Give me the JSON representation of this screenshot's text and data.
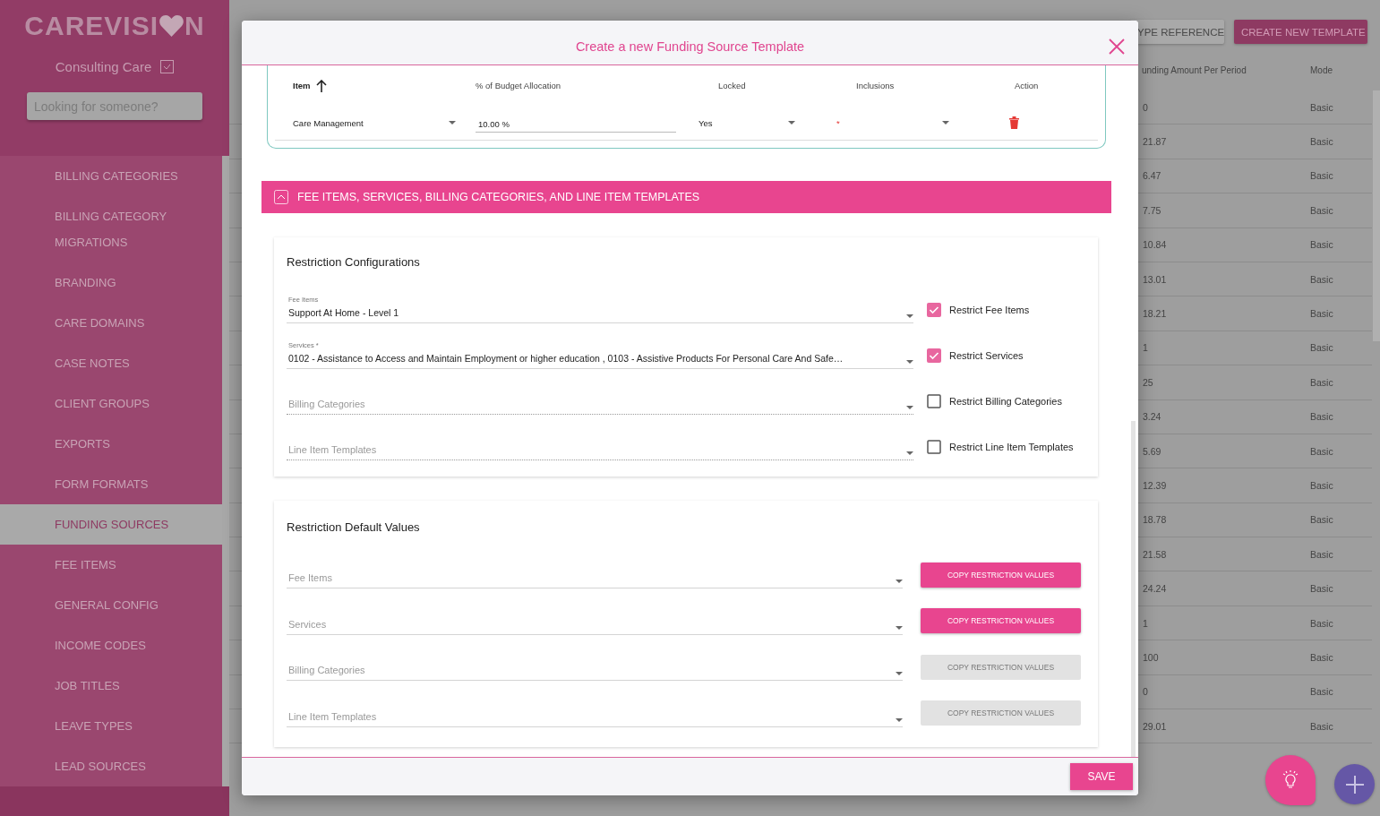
{
  "sidebar": {
    "logo": {
      "before_heart": "CAREVISI",
      "after_heart": "N"
    },
    "organisation": "Consulting Care",
    "search": {
      "placeholder": "Looking for someone?"
    },
    "items": [
      {
        "label": "BILLING CATEGORIES",
        "selected": false
      },
      {
        "label": "BILLING CATEGORY MIGRATIONS",
        "selected": false
      },
      {
        "label": "BRANDING",
        "selected": false
      },
      {
        "label": "CARE DOMAINS",
        "selected": false
      },
      {
        "label": "CASE NOTES",
        "selected": false
      },
      {
        "label": "CLIENT GROUPS",
        "selected": false
      },
      {
        "label": "EXPORTS",
        "selected": false
      },
      {
        "label": "FORM FORMATS",
        "selected": false
      },
      {
        "label": "FUNDING SOURCES",
        "selected": true
      },
      {
        "label": "FEE ITEMS",
        "selected": false
      },
      {
        "label": "GENERAL CONFIG",
        "selected": false
      },
      {
        "label": "INCOME CODES",
        "selected": false
      },
      {
        "label": "JOB TITLES",
        "selected": false
      },
      {
        "label": "LEAVE TYPES",
        "selected": false
      },
      {
        "label": "LEAD SOURCES",
        "selected": false
      }
    ]
  },
  "page": {
    "buttons": [
      {
        "label": "YPE REFERENCE",
        "kind": "secondary"
      },
      {
        "label": "CREATE NEW TEMPLATE",
        "kind": "primary"
      }
    ],
    "table": {
      "columns": [
        "unding Amount Per Period",
        "Mode"
      ],
      "rows": [
        {
          "amount": "0",
          "mode": "Basic"
        },
        {
          "amount": "21.87",
          "mode": "Basic"
        },
        {
          "amount": "6.47",
          "mode": "Basic"
        },
        {
          "amount": "7.75",
          "mode": "Basic"
        },
        {
          "amount": "10.84",
          "mode": "Basic"
        },
        {
          "amount": "13.01",
          "mode": "Basic"
        },
        {
          "amount": "18.21",
          "mode": "Basic"
        },
        {
          "amount": "1",
          "mode": "Basic"
        },
        {
          "amount": "25",
          "mode": "Basic"
        },
        {
          "amount": "3.24",
          "mode": "Basic"
        },
        {
          "amount": "5.69",
          "mode": "Basic"
        },
        {
          "amount": "12.39",
          "mode": "Basic"
        },
        {
          "amount": "18.78",
          "mode": "Basic"
        },
        {
          "amount": "21.58",
          "mode": "Basic"
        },
        {
          "amount": "24.24",
          "mode": "Basic"
        },
        {
          "amount": "1",
          "mode": "Basic"
        },
        {
          "amount": "100",
          "mode": "Basic"
        },
        {
          "amount": "0",
          "mode": "Basic"
        },
        {
          "amount": "29.01",
          "mode": "Basic"
        }
      ]
    }
  },
  "modal": {
    "title": "Create a new Funding Source Template",
    "items_table": {
      "columns": [
        "Item",
        "% of Budget Allocation",
        "Locked",
        "Inclusions",
        "Action"
      ],
      "sort_ascending": true,
      "rows": [
        {
          "item": "Care Management",
          "allocation": "10.00 %",
          "locked": "Yes",
          "inclusions": "*"
        }
      ]
    },
    "section": {
      "title": "FEE ITEMS, SERVICES, BILLING CATEGORIES, AND LINE ITEM TEMPLATES",
      "expanded": true
    },
    "restriction_configurations": {
      "title": "Restriction Configurations",
      "rows": [
        {
          "label": "Fee Items",
          "value": "Support At Home - Level 1",
          "disabled": false,
          "checkbox_label": "Restrict Fee Items",
          "checked": true
        },
        {
          "label": "Services *",
          "value": "0102 - Assistance to Access and Maintain Employment or higher education , 0103 - Assistive Products For Personal Care And Safe…",
          "disabled": false,
          "checkbox_label": "Restrict Services",
          "checked": true
        },
        {
          "placeholder": "Billing Categories",
          "disabled": true,
          "checkbox_label": "Restrict Billing Categories",
          "checked": false
        },
        {
          "placeholder": "Line Item Templates",
          "disabled": true,
          "checkbox_label": "Restrict Line Item Templates",
          "checked": false
        }
      ]
    },
    "restriction_defaults": {
      "title": "Restriction Default Values",
      "rows": [
        {
          "placeholder": "Fee Items",
          "button": "COPY RESTRICTION VALUES",
          "disabled": false
        },
        {
          "placeholder": "Services",
          "button": "COPY RESTRICTION VALUES",
          "disabled": false
        },
        {
          "placeholder": "Billing Categories",
          "button": "COPY RESTRICTION VALUES",
          "disabled": true
        },
        {
          "placeholder": "Line Item Templates",
          "button": "COPY RESTRICTION VALUES",
          "disabled": true
        }
      ]
    },
    "save": "SAVE"
  }
}
